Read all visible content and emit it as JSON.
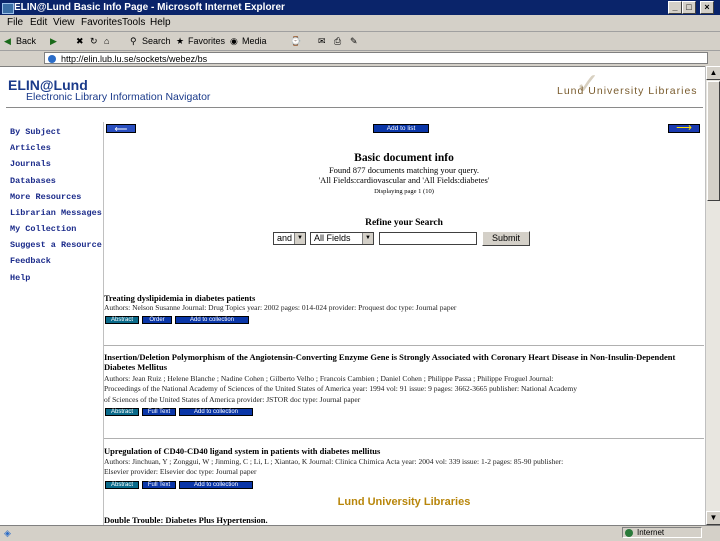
{
  "window": {
    "title": "ELIN@Lund  Basic Info  Page - Microsoft Internet Explorer",
    "controls": [
      "_",
      "□",
      "×"
    ]
  },
  "menu": [
    "File",
    "Edit",
    "View",
    "Favorites",
    "Tools",
    "Help"
  ],
  "toolbar": {
    "back": "Back",
    "search": "Search",
    "favorites": "Favorites",
    "media": "Media"
  },
  "address": {
    "url": "http://elin.lub.lu.se/sockets/webez/bs"
  },
  "header": {
    "logo": "ELIN@Lund",
    "subtitle": "Electronic Library Information Navigator",
    "lund_logo": "Lund University Libraries"
  },
  "sidebar": {
    "items": [
      {
        "label": "By Subject"
      },
      {
        "label": "Articles"
      },
      {
        "label": "Journals"
      },
      {
        "label": "Databases"
      },
      {
        "label": "More Resources"
      },
      {
        "label": "Librarian Messages"
      },
      {
        "label": "My Collection"
      },
      {
        "label": "Suggest a Resource"
      },
      {
        "label": "Feedback"
      },
      {
        "label": "Help"
      }
    ]
  },
  "content": {
    "add_to_list": "Add to list",
    "heading": "Basic document info",
    "found": "Found 877 documents matching your query.",
    "query": "'All Fields:cardiovascular and 'All Fields:diabetes'",
    "displaying": "Displaying page 1 (10)",
    "refine_label": "Refine your Search",
    "operator_value": "and",
    "field_value": "All Fields",
    "search_value": "",
    "submit_label": "Submit"
  },
  "records": [
    {
      "title": "Treating dyslipidemia in diabetes patients",
      "meta": [
        "Authors: Nelson Susanne  Journal: Drug Topics  year: 2002  pages: 014-024  provider: Proquest  doc type: Journal paper"
      ],
      "buttons": [
        "Abstract",
        "Order",
        "Add to collection"
      ]
    },
    {
      "title": "Insertion/Deletion Polymorphism of the Angiotensin-Converting Enzyme Gene is Strongly Associated with Coronary Heart Disease in Non-Insulin-Dependent Diabetes Mellitus",
      "meta": [
        "Authors: Jean Ruiz ; Helene Blanche ; Nadine Cohen ; Gilberto Velho ; Francois Cambien ; Daniel Cohen ; Philippe Passa ; Philippe Froguel  Journal:",
        "Proceedings of the National Academy of Sciences of the United States of America  year: 1994  vol: 91  issue: 9  pages: 3662-3665  publisher: National Academy",
        "of Sciences of the United States of America  provider: JSTOR  doc type: Journal paper"
      ],
      "buttons": [
        "Abstract",
        "Full Text",
        "Add to collection"
      ]
    },
    {
      "title": "Upregulation of CD40-CD40 ligand system in patients with diabetes mellitus",
      "meta": [
        "Authors: Jinchuan, Y ; Zonggui, W ; Jinming, C ; Li, L ; Xiantao, K  Journal: Clinica Chimica Acta  year: 2004  vol: 339  issue: 1-2  pages: 85-90  publisher:",
        "Elsevier  provider: Elsevier  doc type: Journal paper"
      ],
      "buttons": [
        "Abstract",
        "Full Text",
        "Add to collection"
      ]
    },
    {
      "title": "Double Trouble: Diabetes Plus Hypertension."
    }
  ],
  "footer": {
    "lund": "Lund University Libraries"
  },
  "status": {
    "zone": "Internet"
  },
  "colors": {
    "titlebar": "#0a246a",
    "link": "#1a2a8a",
    "button_blue": "#0a36a8",
    "footer_gold": "#b8860b"
  }
}
